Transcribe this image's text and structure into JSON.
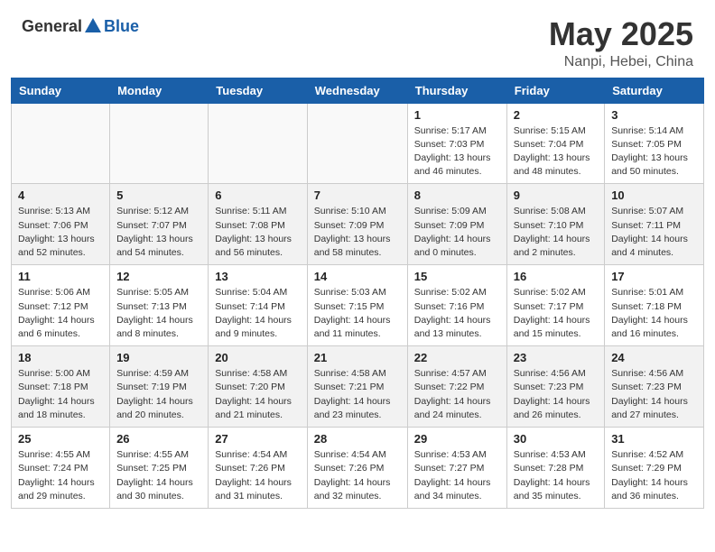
{
  "header": {
    "logo_general": "General",
    "logo_blue": "Blue",
    "month": "May 2025",
    "location": "Nanpi, Hebei, China"
  },
  "weekdays": [
    "Sunday",
    "Monday",
    "Tuesday",
    "Wednesday",
    "Thursday",
    "Friday",
    "Saturday"
  ],
  "weeks": [
    [
      {
        "day": "",
        "info": ""
      },
      {
        "day": "",
        "info": ""
      },
      {
        "day": "",
        "info": ""
      },
      {
        "day": "",
        "info": ""
      },
      {
        "day": "1",
        "info": "Sunrise: 5:17 AM\nSunset: 7:03 PM\nDaylight: 13 hours\nand 46 minutes."
      },
      {
        "day": "2",
        "info": "Sunrise: 5:15 AM\nSunset: 7:04 PM\nDaylight: 13 hours\nand 48 minutes."
      },
      {
        "day": "3",
        "info": "Sunrise: 5:14 AM\nSunset: 7:05 PM\nDaylight: 13 hours\nand 50 minutes."
      }
    ],
    [
      {
        "day": "4",
        "info": "Sunrise: 5:13 AM\nSunset: 7:06 PM\nDaylight: 13 hours\nand 52 minutes."
      },
      {
        "day": "5",
        "info": "Sunrise: 5:12 AM\nSunset: 7:07 PM\nDaylight: 13 hours\nand 54 minutes."
      },
      {
        "day": "6",
        "info": "Sunrise: 5:11 AM\nSunset: 7:08 PM\nDaylight: 13 hours\nand 56 minutes."
      },
      {
        "day": "7",
        "info": "Sunrise: 5:10 AM\nSunset: 7:09 PM\nDaylight: 13 hours\nand 58 minutes."
      },
      {
        "day": "8",
        "info": "Sunrise: 5:09 AM\nSunset: 7:09 PM\nDaylight: 14 hours\nand 0 minutes."
      },
      {
        "day": "9",
        "info": "Sunrise: 5:08 AM\nSunset: 7:10 PM\nDaylight: 14 hours\nand 2 minutes."
      },
      {
        "day": "10",
        "info": "Sunrise: 5:07 AM\nSunset: 7:11 PM\nDaylight: 14 hours\nand 4 minutes."
      }
    ],
    [
      {
        "day": "11",
        "info": "Sunrise: 5:06 AM\nSunset: 7:12 PM\nDaylight: 14 hours\nand 6 minutes."
      },
      {
        "day": "12",
        "info": "Sunrise: 5:05 AM\nSunset: 7:13 PM\nDaylight: 14 hours\nand 8 minutes."
      },
      {
        "day": "13",
        "info": "Sunrise: 5:04 AM\nSunset: 7:14 PM\nDaylight: 14 hours\nand 9 minutes."
      },
      {
        "day": "14",
        "info": "Sunrise: 5:03 AM\nSunset: 7:15 PM\nDaylight: 14 hours\nand 11 minutes."
      },
      {
        "day": "15",
        "info": "Sunrise: 5:02 AM\nSunset: 7:16 PM\nDaylight: 14 hours\nand 13 minutes."
      },
      {
        "day": "16",
        "info": "Sunrise: 5:02 AM\nSunset: 7:17 PM\nDaylight: 14 hours\nand 15 minutes."
      },
      {
        "day": "17",
        "info": "Sunrise: 5:01 AM\nSunset: 7:18 PM\nDaylight: 14 hours\nand 16 minutes."
      }
    ],
    [
      {
        "day": "18",
        "info": "Sunrise: 5:00 AM\nSunset: 7:18 PM\nDaylight: 14 hours\nand 18 minutes."
      },
      {
        "day": "19",
        "info": "Sunrise: 4:59 AM\nSunset: 7:19 PM\nDaylight: 14 hours\nand 20 minutes."
      },
      {
        "day": "20",
        "info": "Sunrise: 4:58 AM\nSunset: 7:20 PM\nDaylight: 14 hours\nand 21 minutes."
      },
      {
        "day": "21",
        "info": "Sunrise: 4:58 AM\nSunset: 7:21 PM\nDaylight: 14 hours\nand 23 minutes."
      },
      {
        "day": "22",
        "info": "Sunrise: 4:57 AM\nSunset: 7:22 PM\nDaylight: 14 hours\nand 24 minutes."
      },
      {
        "day": "23",
        "info": "Sunrise: 4:56 AM\nSunset: 7:23 PM\nDaylight: 14 hours\nand 26 minutes."
      },
      {
        "day": "24",
        "info": "Sunrise: 4:56 AM\nSunset: 7:23 PM\nDaylight: 14 hours\nand 27 minutes."
      }
    ],
    [
      {
        "day": "25",
        "info": "Sunrise: 4:55 AM\nSunset: 7:24 PM\nDaylight: 14 hours\nand 29 minutes."
      },
      {
        "day": "26",
        "info": "Sunrise: 4:55 AM\nSunset: 7:25 PM\nDaylight: 14 hours\nand 30 minutes."
      },
      {
        "day": "27",
        "info": "Sunrise: 4:54 AM\nSunset: 7:26 PM\nDaylight: 14 hours\nand 31 minutes."
      },
      {
        "day": "28",
        "info": "Sunrise: 4:54 AM\nSunset: 7:26 PM\nDaylight: 14 hours\nand 32 minutes."
      },
      {
        "day": "29",
        "info": "Sunrise: 4:53 AM\nSunset: 7:27 PM\nDaylight: 14 hours\nand 34 minutes."
      },
      {
        "day": "30",
        "info": "Sunrise: 4:53 AM\nSunset: 7:28 PM\nDaylight: 14 hours\nand 35 minutes."
      },
      {
        "day": "31",
        "info": "Sunrise: 4:52 AM\nSunset: 7:29 PM\nDaylight: 14 hours\nand 36 minutes."
      }
    ]
  ]
}
